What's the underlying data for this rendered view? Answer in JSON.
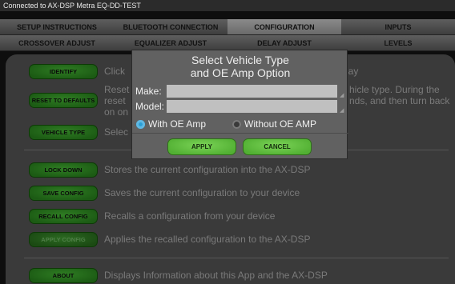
{
  "status": {
    "text": "Connected to AX-DSP Metra EQ-DD-TEST"
  },
  "tabs_row1": [
    {
      "label": "SETUP INSTRUCTIONS"
    },
    {
      "label": "BLUETOOTH CONNECTION"
    },
    {
      "label": "CONFIGURATION",
      "active": true
    },
    {
      "label": "INPUTS"
    }
  ],
  "tabs_row2": [
    {
      "label": "CROSSOVER ADJUST"
    },
    {
      "label": "EQUALIZER ADJUST"
    },
    {
      "label": "DELAY ADJUST"
    },
    {
      "label": "LEVELS"
    }
  ],
  "config": {
    "identify": {
      "label": "IDENTIFY",
      "desc": "Click",
      "desc_tail": "lay"
    },
    "reset": {
      "label": "RESET TO DEFAULTS",
      "desc": "Reset\nreset\non on",
      "desc_tail": "hicle type. During the\nnds, and then turn back"
    },
    "vehicle": {
      "label": "VEHICLE TYPE",
      "desc": "Selec"
    },
    "lockdown": {
      "label": "LOCK DOWN",
      "desc": "Stores the current configuration into the AX-DSP"
    },
    "save": {
      "label": "SAVE CONFIG",
      "desc": "Saves the current configuration to your device"
    },
    "recall": {
      "label": "RECALL CONFIG",
      "desc": "Recalls a configuration from your device"
    },
    "apply": {
      "label": "APPLY CONFIG",
      "desc": "Applies the recalled configuration to the AX-DSP"
    },
    "about": {
      "label": "ABOUT",
      "desc": "Displays Information about this App and the AX-DSP"
    }
  },
  "dialog": {
    "title_line1": "Select Vehicle Type",
    "title_line2": "and OE Amp Option",
    "make_label": "Make:",
    "make_value": "",
    "model_label": "Model:",
    "model_value": "",
    "option_with": "With OE Amp",
    "option_without": "Without OE AMP",
    "selected_option": "With OE Amp",
    "apply_label": "APPLY",
    "cancel_label": "CANCEL"
  }
}
